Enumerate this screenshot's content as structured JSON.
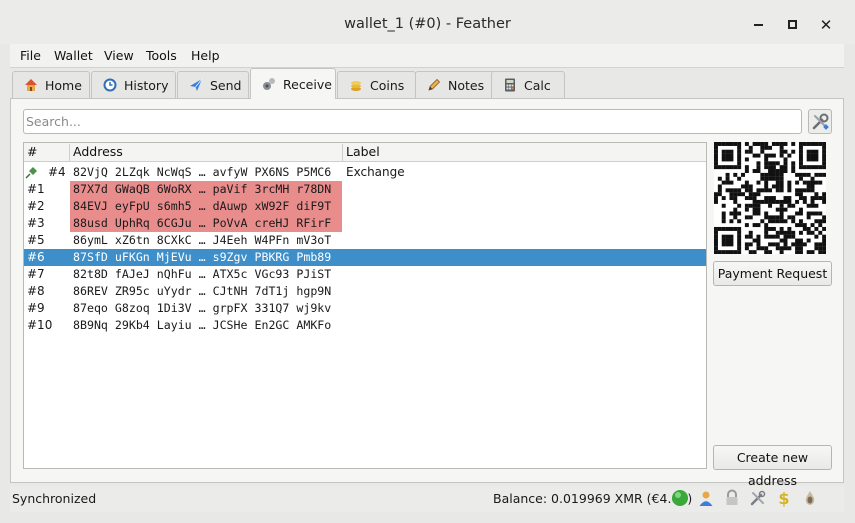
{
  "window": {
    "title": "wallet_1 (#0) - Feather"
  },
  "menu": [
    "File",
    "Wallet",
    "View",
    "Tools",
    "Help"
  ],
  "tabs": [
    {
      "label": "Home",
      "icon": "home-icon"
    },
    {
      "label": "History",
      "icon": "history-icon"
    },
    {
      "label": "Send",
      "icon": "send-icon"
    },
    {
      "label": "Receive",
      "icon": "receive-icon",
      "active": true
    },
    {
      "label": "Coins",
      "icon": "coins-icon"
    },
    {
      "label": "Notes",
      "icon": "pencil-icon"
    },
    {
      "label": "Calc",
      "icon": "calculator-icon"
    }
  ],
  "search": {
    "placeholder": "Search...",
    "value": ""
  },
  "table": {
    "headers": [
      "#",
      "Address",
      "Label"
    ],
    "rows": [
      {
        "index": "#4",
        "pinned": true,
        "address": "82VjQ 2LZqk NcWqS … avfyW PX6NS P5MC6",
        "label": "Exchange",
        "used": false,
        "selected": false
      },
      {
        "index": "#1",
        "address": "87X7d GWaQB 6WoRX … paVif 3rcMH r78DN",
        "label": "",
        "used": true,
        "selected": false
      },
      {
        "index": "#2",
        "address": "84EVJ eyFpU s6mh5 … dAuwp xW92F diF9T",
        "label": "",
        "used": true,
        "selected": false
      },
      {
        "index": "#3",
        "address": "88usd UphRq 6CGJu … PoVvA creHJ RFirF",
        "label": "",
        "used": true,
        "selected": false
      },
      {
        "index": "#5",
        "address": "86ymL xZ6tn 8CXkC … J4Eeh W4PFn mV3oT",
        "label": "",
        "used": false,
        "selected": false
      },
      {
        "index": "#6",
        "address": "87SfD uFKGn MjEVu … s9Zgv PBKRG Pmb89",
        "label": "",
        "used": true,
        "selected": true
      },
      {
        "index": "#7",
        "address": "82t8D fAJeJ nQhFu … ATX5c VGc93 PJiST",
        "label": "",
        "used": false,
        "selected": false
      },
      {
        "index": "#8",
        "address": "86REV ZR95c uYydr … CJtNH 7dT1j hgp9N",
        "label": "",
        "used": false,
        "selected": false
      },
      {
        "index": "#9",
        "address": "87eqo G8zoq 1Di3V … grpFX 331Q7 wj9kv",
        "label": "",
        "used": false,
        "selected": false
      },
      {
        "index": "#10",
        "address": "8B9Nq 29Kb4 Layiu … JCSHe En2GC AMKFo",
        "label": "",
        "used": false,
        "selected": false
      }
    ]
  },
  "buttons": {
    "payment_request": "Payment Request",
    "create_address": "Create new address"
  },
  "status": {
    "sync": "Synchronized",
    "balance": "Balance: 0.019969 XMR (€4.02)",
    "icons": [
      "connection-status-icon",
      "account-icon",
      "lock-icon",
      "settings-icon",
      "seed-icon",
      "tor-icon"
    ]
  },
  "colors": {
    "selected_row": "#3d8ec9",
    "used_address": "#e88c8c",
    "status_online": "#3aa83a"
  }
}
